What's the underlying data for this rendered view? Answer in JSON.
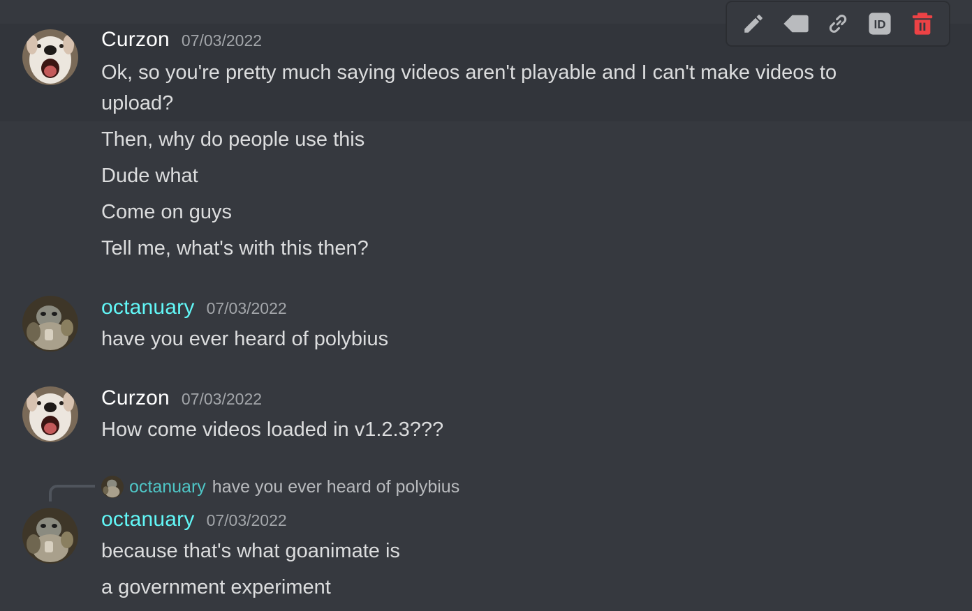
{
  "toolbar": {
    "edit_icon": "pencil-icon",
    "reply_icon": "reply-icon",
    "link_icon": "link-icon",
    "id_label": "ID",
    "delete_icon": "trash-icon",
    "delete_color": "#ed4245"
  },
  "messages": [
    {
      "author": "Curzon",
      "author_color": "#ffffff",
      "timestamp": "07/03/2022",
      "lines": [
        "Ok, so you're pretty much saying videos aren't playable and I can't make videos to",
        "upload?",
        "Then, why do people use this",
        "Dude what",
        "Come on guys",
        "Tell me, what's with this then?"
      ]
    },
    {
      "author": "octanuary",
      "author_color": "#62f7f7",
      "timestamp": "07/03/2022",
      "lines": [
        "have you ever heard of polybius"
      ]
    },
    {
      "author": "Curzon",
      "author_color": "#ffffff",
      "timestamp": "07/03/2022",
      "lines": [
        "How come videos loaded in v1.2.3???"
      ]
    },
    {
      "reply_to": {
        "author": "octanuary",
        "text": "have you ever heard of polybius"
      },
      "author": "octanuary",
      "author_color": "#62f7f7",
      "timestamp": "07/03/2022",
      "lines": [
        "because that's what goanimate is",
        "a government experiment"
      ]
    }
  ]
}
